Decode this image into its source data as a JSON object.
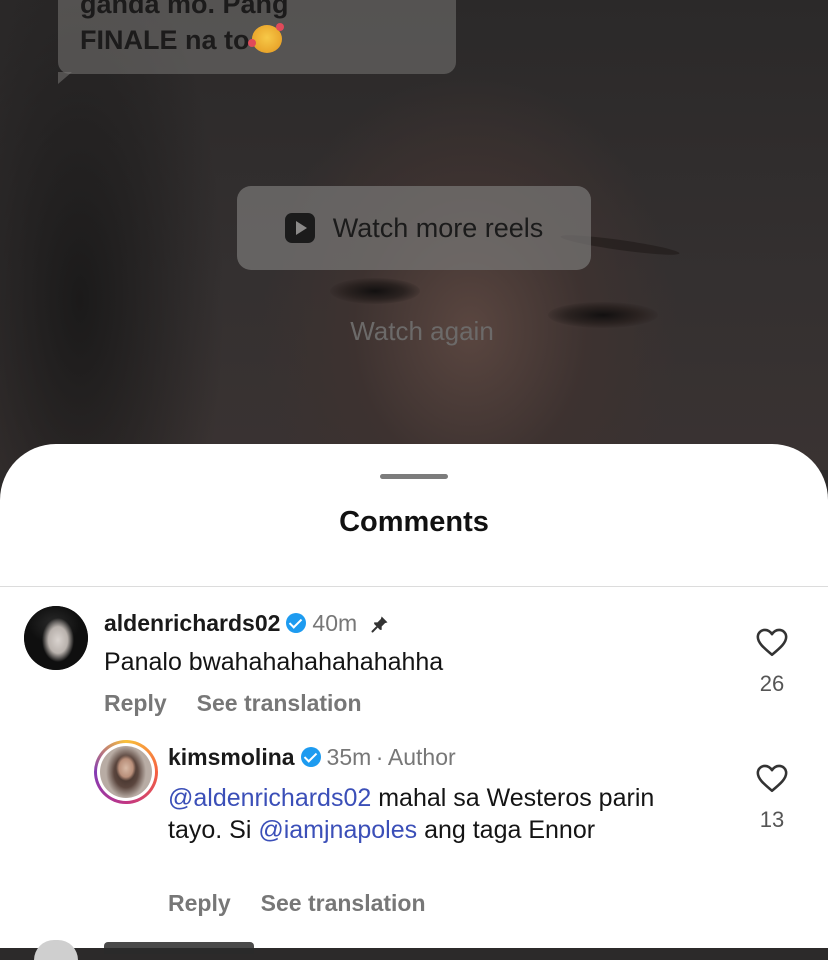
{
  "video": {
    "caption_line1": "ganda mo. Pang",
    "caption_line2": "FINALE na to",
    "watch_more_label": "Watch more reels",
    "watch_again_label": "Watch again"
  },
  "sheet": {
    "title": "Comments"
  },
  "comments": [
    {
      "username": "aldenrichards02",
      "time": "40m",
      "text": "Panalo bwahahahahahahahha",
      "reply_label": "Reply",
      "translate_label": "See translation",
      "likes": "26"
    },
    {
      "username": "kimsmolina",
      "time": "35m",
      "separator": "·",
      "author_label": "Author",
      "mention1": "@aldenrichards02",
      "text_part1": " mahal sa Westeros parin tayo. Si ",
      "mention2": "@iamjnapoles",
      "text_part2": " ang taga Ennor",
      "reply_label": "Reply",
      "translate_label": "See translation",
      "likes": "13"
    }
  ],
  "icons": {
    "reel": "reels-play-icon",
    "verified": "verified-badge-icon",
    "pin": "pin-icon",
    "heart": "heart-outline-icon"
  },
  "colors": {
    "mention": "#3b4fb8",
    "verified": "#1d9bf0",
    "sheet_bg": "#ffffff"
  }
}
